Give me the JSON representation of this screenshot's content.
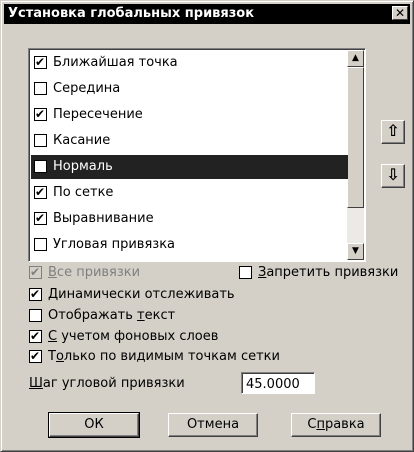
{
  "window": {
    "title": "Установка глобальных привязок",
    "close_glyph": "✕"
  },
  "list": {
    "items": [
      {
        "label": "Ближайшая точка",
        "checked": true
      },
      {
        "label": "Середина",
        "checked": false
      },
      {
        "label": "Пересечение",
        "checked": true
      },
      {
        "label": "Касание",
        "checked": false
      },
      {
        "label": "Нормаль",
        "checked": false,
        "selected": true
      },
      {
        "label": "По сетке",
        "checked": true
      },
      {
        "label": "Выравнивание",
        "checked": true
      },
      {
        "label": "Угловая привязка",
        "checked": false
      }
    ],
    "scroll_up_glyph": "▲",
    "scroll_down_glyph": "▼"
  },
  "move_up_glyph": "⇧",
  "move_down_glyph": "⇩",
  "options": {
    "all_snaps": {
      "u": "В",
      "rest": "се привязки",
      "checked": true,
      "disabled": true
    },
    "forbid_snaps": {
      "u": "З",
      "rest": "апретить привязки",
      "checked": false
    },
    "dynamic_tracking": {
      "u": "Д",
      "rest": "инамически отслеживать",
      "checked": true
    },
    "show_text": {
      "pre": "Отображать ",
      "u": "т",
      "rest": "екст",
      "checked": false
    },
    "background_layers": {
      "u": "С",
      "rest": " учетом фоновых слоев",
      "checked": true
    },
    "visible_grid_points": {
      "pre": "Т",
      "u": "о",
      "rest": "лько по видимым точкам сетки",
      "checked": true
    }
  },
  "angle_step": {
    "u": "Ш",
    "rest": "аг угловой привязки",
    "value": "45.0000"
  },
  "buttons": {
    "ok": "ОК",
    "cancel": "Отмена",
    "help_pre": "С",
    "help_u": "п",
    "help_rest": "равка"
  }
}
